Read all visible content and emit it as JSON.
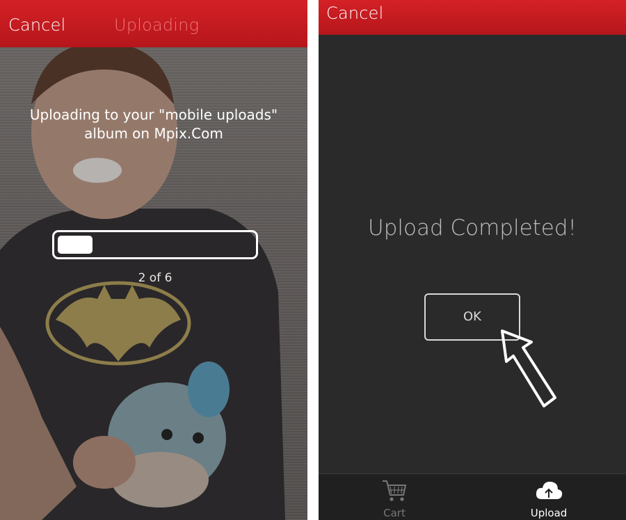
{
  "upload_screen": {
    "cancel_label": "Cancel",
    "title": "Uploading",
    "message_line1": "Uploading to your \"mobile uploads\"",
    "message_line2": "album on Mpix.Com",
    "progress_fraction": 0.18,
    "progress_text": "2 of 6"
  },
  "complete_screen": {
    "cancel_label": "Cancel",
    "message": "Upload Completed!",
    "ok_label": "OK",
    "tabs": [
      {
        "label": "Cart",
        "icon": "cart-icon",
        "active": false
      },
      {
        "label": "Upload",
        "icon": "cloud-upload-icon",
        "active": true
      }
    ]
  },
  "colors": {
    "header_red": "#c41c21",
    "title_inactive": "#f07377",
    "dark_bg": "#2a2a2b"
  }
}
